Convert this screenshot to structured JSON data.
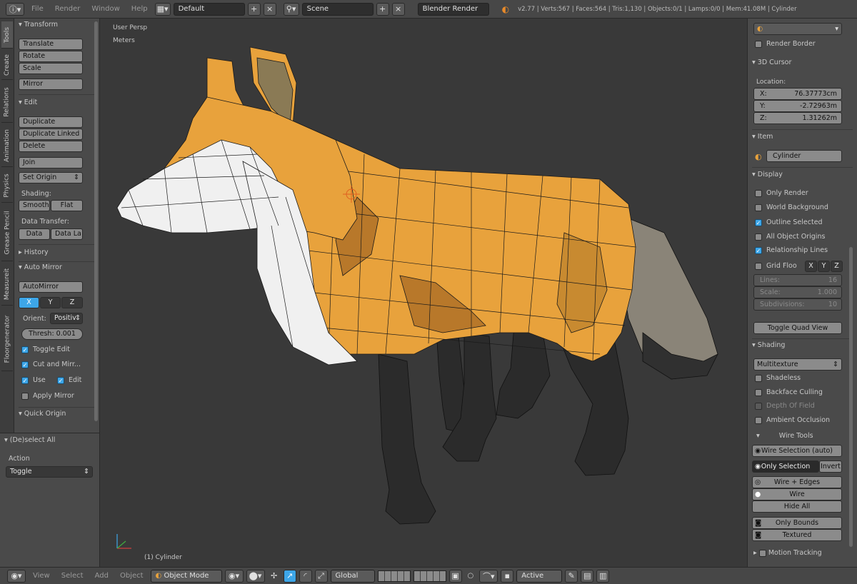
{
  "topbar": {
    "menus": [
      "File",
      "Render",
      "Window",
      "Help"
    ],
    "screen_layout": "Default",
    "scene": "Scene",
    "engine": "Blender Render",
    "stats": "v2.77 | Verts:567 | Faces:564 | Tris:1,130 | Objects:0/1 | Lamps:0/0 | Mem:41.08M | Cylinder"
  },
  "tabs": [
    "Tools",
    "Create",
    "Relations",
    "Animation",
    "Physics",
    "Grease Pencil",
    "Measureit",
    "Floorgenerator"
  ],
  "tools": {
    "transform_header": "Transform",
    "translate": "Translate",
    "rotate": "Rotate",
    "scale": "Scale",
    "mirror": "Mirror",
    "edit_header": "Edit",
    "duplicate": "Duplicate",
    "duplicate_linked": "Duplicate Linked",
    "delete": "Delete",
    "join": "Join",
    "set_origin": "Set Origin",
    "shading_label": "Shading:",
    "smooth": "Smooth",
    "flat": "Flat",
    "data_transfer_label": "Data Transfer:",
    "data": "Data",
    "data_la": "Data La",
    "history_header": "History",
    "automirror_header": "Auto Mirror",
    "automirror": "AutoMirror",
    "axis_x": "X",
    "axis_y": "Y",
    "axis_z": "Z",
    "orient_label": "Orient:",
    "orient_value": "Positiv",
    "thresh": "Thresh: 0.001",
    "toggle_edit": "Toggle Edit",
    "cut_and_mirror": "Cut and Mirr...",
    "use": "Use",
    "edit": "Edit",
    "apply_mirror": "Apply Mirror",
    "quick_origin_header": "Quick Origin"
  },
  "operator": {
    "header": "(De)select All",
    "action_label": "Action",
    "action_value": "Toggle"
  },
  "viewport": {
    "view_name": "User Persp",
    "units": "Meters",
    "object_label": "(1) Cylinder"
  },
  "props": {
    "render_border": "Render Border",
    "cursor_header": "3D Cursor",
    "location_label": "Location:",
    "x_label": "X:",
    "x_value": "76.37773cm",
    "y_label": "Y:",
    "y_value": "-2.72963m",
    "z_label": "Z:",
    "z_value": "1.31262m",
    "item_header": "Item",
    "item_name": "Cylinder",
    "display_header": "Display",
    "only_render": "Only Render",
    "world_background": "World Background",
    "outline_selected": "Outline Selected",
    "all_object_origins": "All Object Origins",
    "relationship_lines": "Relationship Lines",
    "grid_floor": "Grid Floo",
    "grid_x": "X",
    "grid_y": "Y",
    "grid_z": "Z",
    "lines_label": "Lines:",
    "lines_value": "16",
    "scale_label": "Scale:",
    "scale_value": "1.000",
    "subdivisions_label": "Subdivisions:",
    "subdivisions_value": "10",
    "toggle_quad_view": "Toggle Quad View",
    "shading_header": "Shading",
    "multitexture": "Multitexture",
    "shadeless": "Shadeless",
    "backface_culling": "Backface Culling",
    "depth_of_field": "Depth Of Field",
    "ambient_occlusion": "Ambient Occlusion",
    "wire_tools_header": "Wire Tools",
    "wire_selection_auto": "Wire Selection (auto)",
    "only_selection": "Only Selection",
    "invert": "Invert",
    "wire_edges": "Wire + Edges",
    "wire": "Wire",
    "hide_all": "Hide All",
    "only_bounds": "Only Bounds",
    "textured": "Textured",
    "motion_tracking": "Motion Tracking"
  },
  "bottombar": {
    "menus": [
      "View",
      "Select",
      "Add",
      "Object"
    ],
    "mode": "Object Mode",
    "orientation": "Global",
    "snap_target": "Active"
  },
  "colors": {
    "accent": "#3da6e8",
    "fox_orange": "#e8a23c",
    "fox_dark_orange": "#b8782a",
    "fox_white": "#f0f0f0",
    "fox_legs": "#2a2a2a",
    "tail_grey": "#8a8478",
    "viewport_bg": "#393939"
  }
}
